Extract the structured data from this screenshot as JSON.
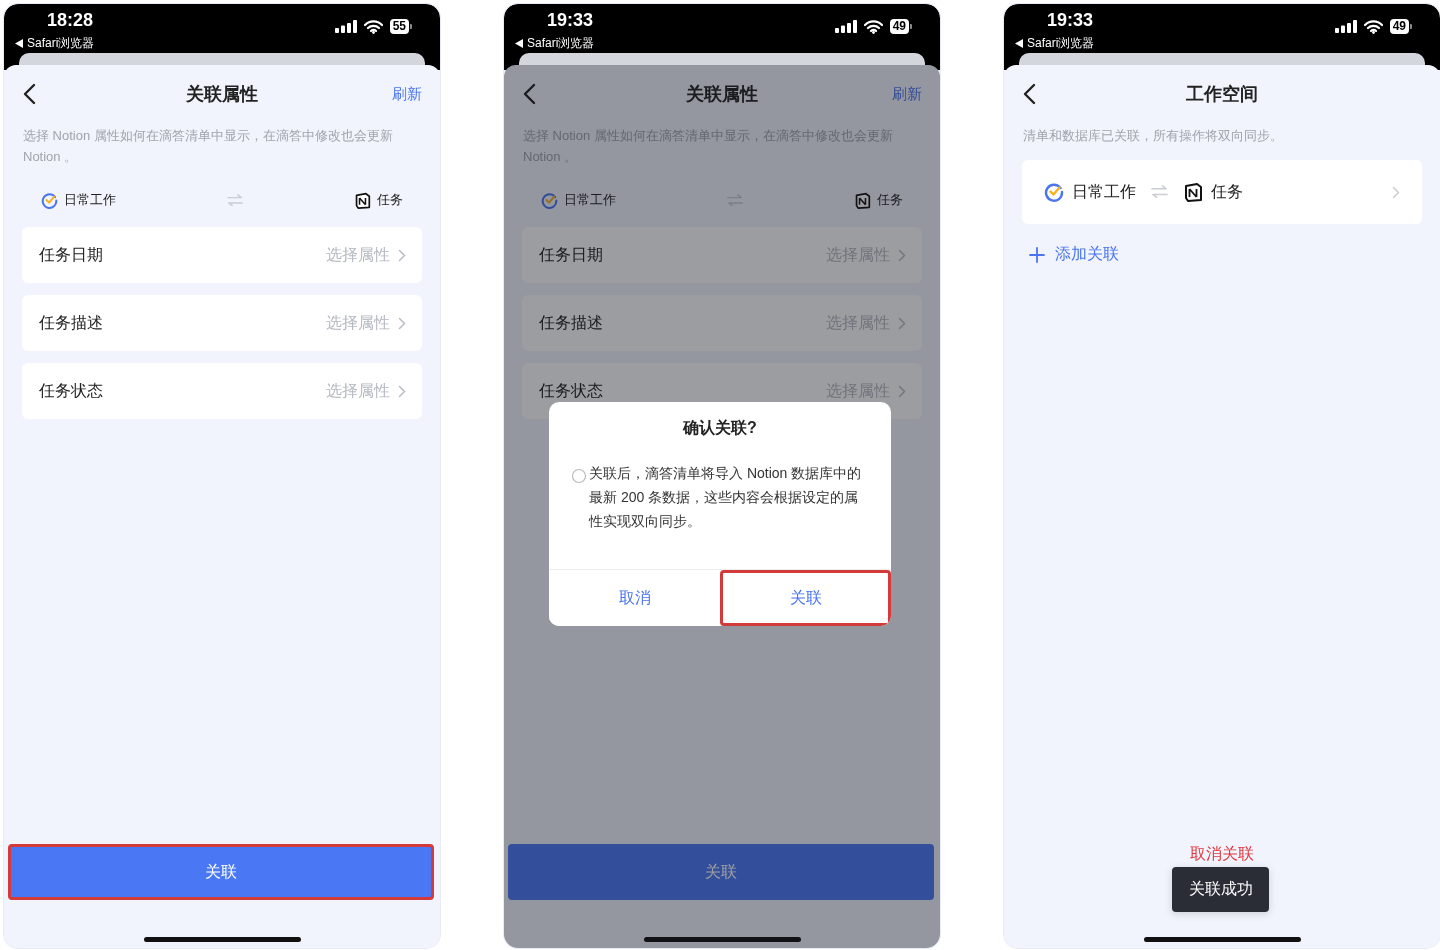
{
  "phones": [
    {
      "kind": "properties",
      "status": {
        "time": "18:28",
        "back_app": "Safari浏览器",
        "battery": "55"
      },
      "header": {
        "title": "关联属性",
        "action": "刷新"
      },
      "description": "选择 Notion 属性如何在滴答清单中显示，在滴答中修改也会更新 Notion 。",
      "link": {
        "source": "日常工作",
        "target": "任务"
      },
      "properties": [
        {
          "name": "任务日期",
          "value": "选择属性"
        },
        {
          "name": "任务描述",
          "value": "选择属性"
        },
        {
          "name": "任务状态",
          "value": "选择属性"
        }
      ],
      "primary_button": {
        "label": "关联",
        "highlighted": true
      },
      "dimmed": false
    },
    {
      "kind": "properties",
      "status": {
        "time": "19:33",
        "back_app": "Safari浏览器",
        "battery": "49"
      },
      "header": {
        "title": "关联属性",
        "action": "刷新"
      },
      "description": "选择 Notion 属性如何在滴答清单中显示，在滴答中修改也会更新 Notion 。",
      "link": {
        "source": "日常工作",
        "target": "任务"
      },
      "properties": [
        {
          "name": "任务日期",
          "value": "选择属性"
        },
        {
          "name": "任务描述",
          "value": "选择属性"
        },
        {
          "name": "任务状态",
          "value": "选择属性"
        }
      ],
      "primary_button": {
        "label": "关联",
        "highlighted": false
      },
      "dimmed": true,
      "dialog": {
        "title": "确认关联?",
        "message": "关联后，滴答清单将导入 Notion 数据库中的最新 200 条数据，这些内容会根据设定的属性实现双向同步。",
        "buttons": [
          {
            "label": "取消",
            "highlighted": false
          },
          {
            "label": "关联",
            "highlighted": true
          }
        ]
      }
    },
    {
      "kind": "workspace",
      "status": {
        "time": "19:33",
        "back_app": "Safari浏览器",
        "battery": "49"
      },
      "header": {
        "title": "工作空间"
      },
      "description": "清单和数据库已关联，所有操作将双向同步。",
      "links": [
        {
          "source": "日常工作",
          "target": "任务"
        }
      ],
      "add_button": "添加关联",
      "unlink_button": "取消关联",
      "toast": "关联成功"
    }
  ]
}
